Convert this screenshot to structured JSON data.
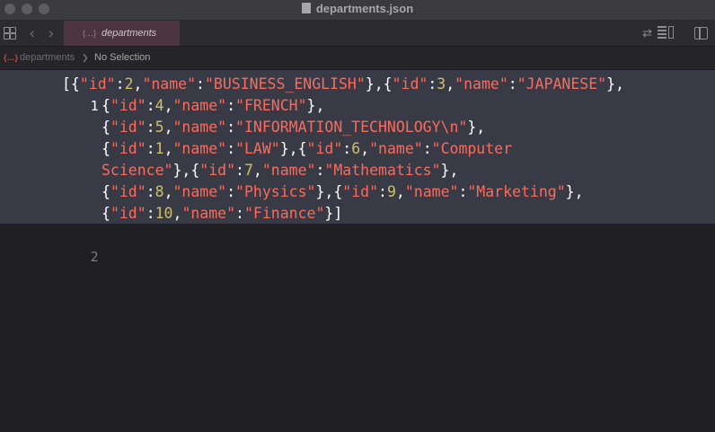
{
  "window": {
    "title": "departments.json"
  },
  "tabbar": {
    "tab_label": "departments",
    "tab_icon_text": "{…}"
  },
  "jumpbar": {
    "icon_text": "{…}",
    "file": "departments",
    "separator": "❯",
    "selection": "No Selection"
  },
  "editor": {
    "line_numbers": [
      "1",
      "2"
    ],
    "visual_rows": [
      [
        [
          "p",
          "[{"
        ],
        [
          "s",
          "\"id\""
        ],
        [
          "p",
          ":"
        ],
        [
          "n",
          "2"
        ],
        [
          "p",
          ","
        ],
        [
          "s",
          "\"name\""
        ],
        [
          "p",
          ":"
        ],
        [
          "s",
          "\"BUSINESS_ENGLISH\""
        ],
        [
          "p",
          "},{"
        ],
        [
          "s",
          "\"id\""
        ],
        [
          "p",
          ":"
        ],
        [
          "n",
          "3"
        ],
        [
          "p",
          ","
        ],
        [
          "s",
          "\"name\""
        ],
        [
          "p",
          ":"
        ],
        [
          "s",
          "\"JAPANESE\""
        ],
        [
          "p",
          "},"
        ]
      ],
      [
        [
          "p",
          "{"
        ],
        [
          "s",
          "\"id\""
        ],
        [
          "p",
          ":"
        ],
        [
          "n",
          "4"
        ],
        [
          "p",
          ","
        ],
        [
          "s",
          "\"name\""
        ],
        [
          "p",
          ":"
        ],
        [
          "s",
          "\"FRENCH\""
        ],
        [
          "p",
          "},"
        ]
      ],
      [
        [
          "p",
          "{"
        ],
        [
          "s",
          "\"id\""
        ],
        [
          "p",
          ":"
        ],
        [
          "n",
          "5"
        ],
        [
          "p",
          ","
        ],
        [
          "s",
          "\"name\""
        ],
        [
          "p",
          ":"
        ],
        [
          "s",
          "\"INFORMATION_TECHNOLOGY\\n\""
        ],
        [
          "p",
          "},"
        ]
      ],
      [
        [
          "p",
          "{"
        ],
        [
          "s",
          "\"id\""
        ],
        [
          "p",
          ":"
        ],
        [
          "n",
          "1"
        ],
        [
          "p",
          ","
        ],
        [
          "s",
          "\"name\""
        ],
        [
          "p",
          ":"
        ],
        [
          "s",
          "\"LAW\""
        ],
        [
          "p",
          "},{"
        ],
        [
          "s",
          "\"id\""
        ],
        [
          "p",
          ":"
        ],
        [
          "n",
          "6"
        ],
        [
          "p",
          ","
        ],
        [
          "s",
          "\"name\""
        ],
        [
          "p",
          ":"
        ],
        [
          "s",
          "\"Computer"
        ]
      ],
      [
        [
          "s",
          "Science\""
        ],
        [
          "p",
          "},{"
        ],
        [
          "s",
          "\"id\""
        ],
        [
          "p",
          ":"
        ],
        [
          "n",
          "7"
        ],
        [
          "p",
          ","
        ],
        [
          "s",
          "\"name\""
        ],
        [
          "p",
          ":"
        ],
        [
          "s",
          "\"Mathematics\""
        ],
        [
          "p",
          "},"
        ]
      ],
      [
        [
          "p",
          "{"
        ],
        [
          "s",
          "\"id\""
        ],
        [
          "p",
          ":"
        ],
        [
          "n",
          "8"
        ],
        [
          "p",
          ","
        ],
        [
          "s",
          "\"name\""
        ],
        [
          "p",
          ":"
        ],
        [
          "s",
          "\"Physics\""
        ],
        [
          "p",
          "},{"
        ],
        [
          "s",
          "\"id\""
        ],
        [
          "p",
          ":"
        ],
        [
          "n",
          "9"
        ],
        [
          "p",
          ","
        ],
        [
          "s",
          "\"name\""
        ],
        [
          "p",
          ":"
        ],
        [
          "s",
          "\"Marketing\""
        ],
        [
          "p",
          "},"
        ]
      ],
      [
        [
          "p",
          "{"
        ],
        [
          "s",
          "\"id\""
        ],
        [
          "p",
          ":"
        ],
        [
          "n",
          "10"
        ],
        [
          "p",
          ","
        ],
        [
          "s",
          "\"name\""
        ],
        [
          "p",
          ":"
        ],
        [
          "s",
          "\"Finance\""
        ],
        [
          "p",
          "}]"
        ]
      ]
    ]
  },
  "colors": {
    "string": "#fc6a5d",
    "number": "#d0bf69",
    "punctuation": "#ffffff",
    "highlight": "#383b45",
    "background": "#1f1f24"
  }
}
